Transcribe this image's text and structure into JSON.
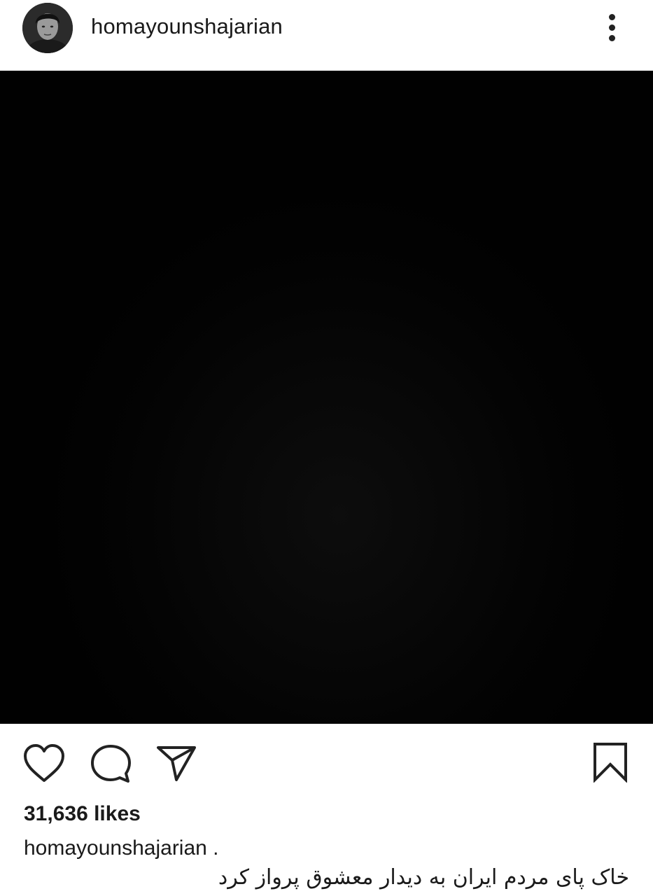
{
  "post": {
    "username": "homayounshajarian",
    "likes": "31,636 likes",
    "caption_user": "homayounshajarian .",
    "caption_text": "خاک پای مردم ایران به دیدار معشوق پرواز کرد"
  },
  "icons": {
    "more": "more-options-icon",
    "like": "heart-icon",
    "comment": "comment-icon",
    "share": "send-icon",
    "save": "bookmark-icon"
  },
  "colors": {
    "text": "#1a1a1a",
    "media_background": "#000000",
    "page_background": "#ffffff"
  }
}
